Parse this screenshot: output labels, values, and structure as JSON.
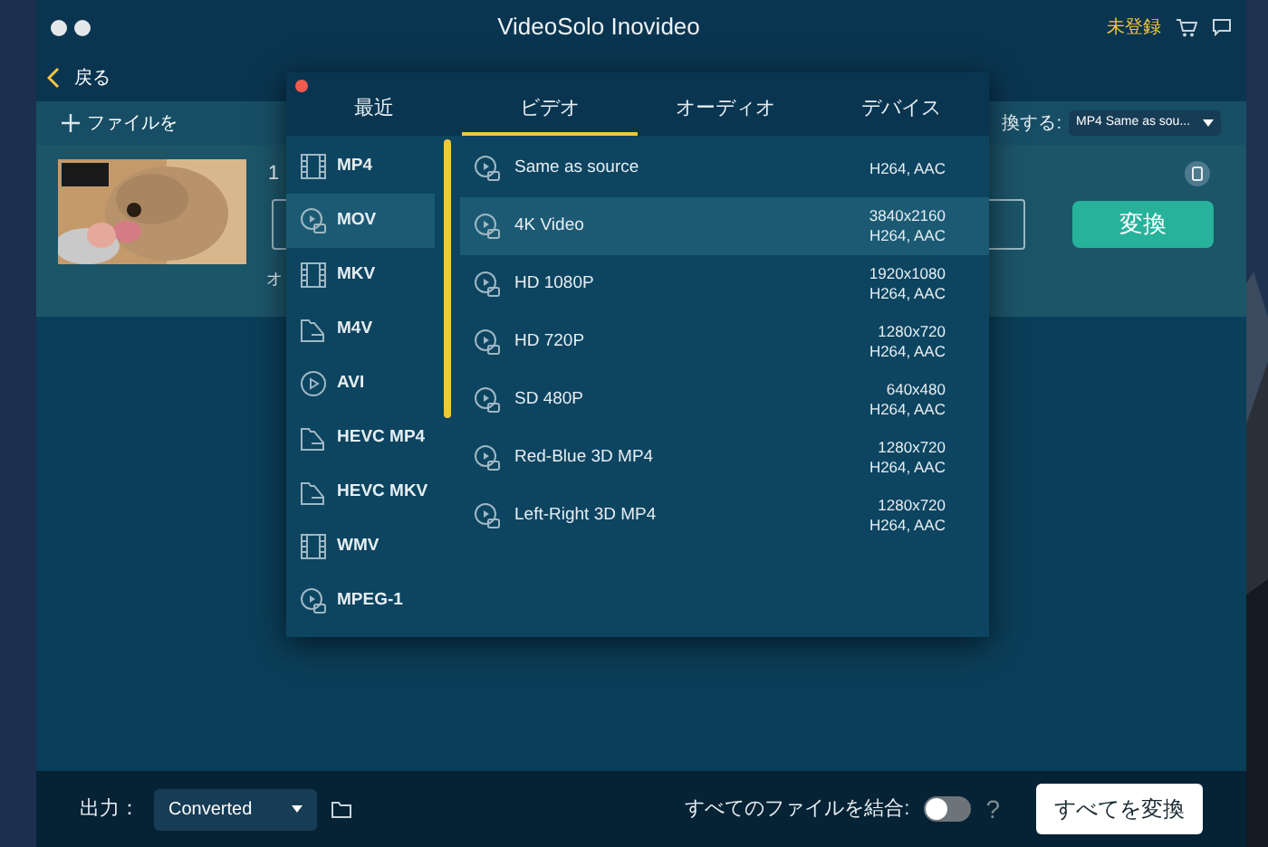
{
  "window": {
    "title": "VideoSolo Inovideo",
    "unregistered": "未登録"
  },
  "nav": {
    "back": "戻る"
  },
  "toolbar": {
    "add_files": "ファイルを",
    "convert_to_label": "換する:",
    "convert_to_value": "MP4 Same as sou..."
  },
  "file": {
    "name_partial": "1",
    "option_partial": "オ",
    "convert_button": "変換"
  },
  "format_popup": {
    "tabs": [
      {
        "label": "最近",
        "selected": false
      },
      {
        "label": "ビデオ",
        "selected": true
      },
      {
        "label": "オーディオ",
        "selected": false
      },
      {
        "label": "デバイス",
        "selected": false
      }
    ],
    "formats": [
      {
        "label": "MP4",
        "kind": "film",
        "selected": false
      },
      {
        "label": "MOV",
        "kind": "disc",
        "selected": true
      },
      {
        "label": "MKV",
        "kind": "film",
        "selected": false
      },
      {
        "label": "M4V",
        "kind": "folder",
        "selected": false
      },
      {
        "label": "AVI",
        "kind": "play",
        "selected": false
      },
      {
        "label": "HEVC MP4",
        "kind": "folder",
        "selected": false
      },
      {
        "label": "HEVC MKV",
        "kind": "folder",
        "selected": false
      },
      {
        "label": "WMV",
        "kind": "film",
        "selected": false
      },
      {
        "label": "MPEG-1",
        "kind": "disc",
        "selected": false
      }
    ],
    "presets": [
      {
        "name": "Same as source",
        "codec": "H264, AAC",
        "selected": false
      },
      {
        "name": "4K Video",
        "resolution": "3840x2160",
        "codec": "H264, AAC",
        "selected": true
      },
      {
        "name": "HD 1080P",
        "resolution": "1920x1080",
        "codec": "H264, AAC",
        "selected": false
      },
      {
        "name": "HD 720P",
        "resolution": "1280x720",
        "codec": "H264, AAC",
        "selected": false
      },
      {
        "name": "SD 480P",
        "resolution": "640x480",
        "codec": "H264, AAC",
        "selected": false
      },
      {
        "name": "Red-Blue 3D MP4",
        "resolution": "1280x720",
        "codec": "H264, AAC",
        "selected": false
      },
      {
        "name": "Left-Right 3D MP4",
        "resolution": "1280x720",
        "codec": "H264, AAC",
        "selected": false
      }
    ]
  },
  "bottom_bar": {
    "output_label": "出力：",
    "output_value": "Converted",
    "merge_label": "すべてのファイルを結合:",
    "merge_on": false,
    "help": "?",
    "convert_all": "すべてを変換"
  }
}
